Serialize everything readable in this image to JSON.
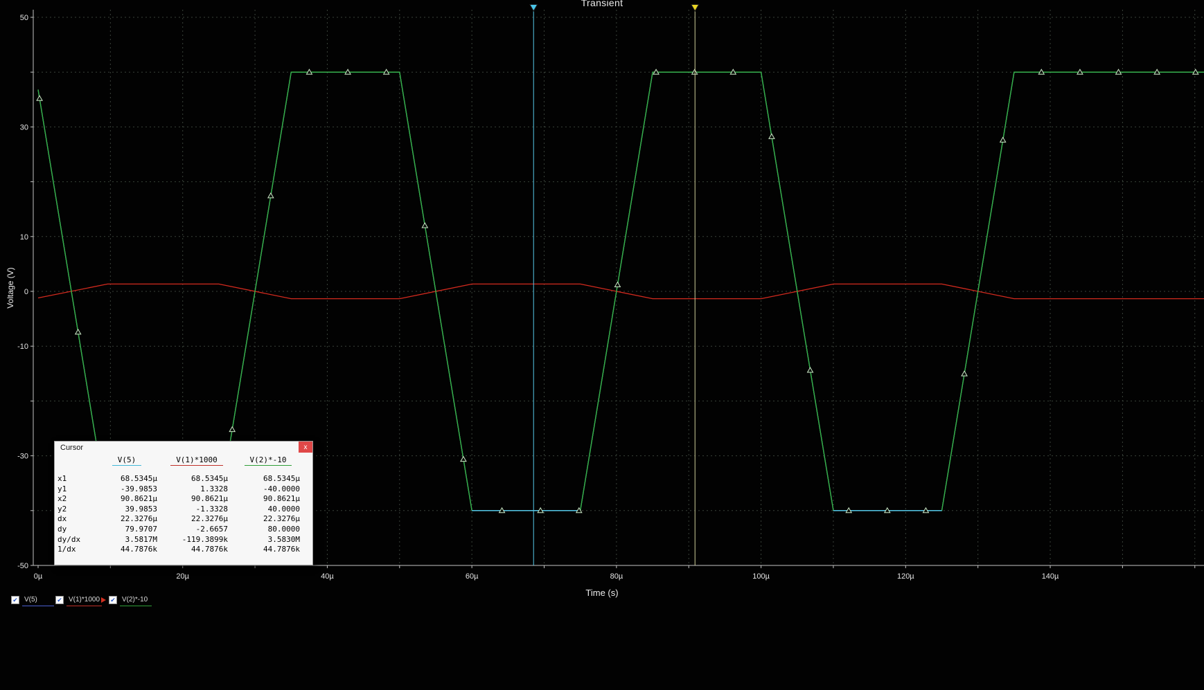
{
  "chart_data": {
    "type": "line",
    "title": "Transient",
    "xlabel": "Time (s)",
    "ylabel": "Voltage (V)",
    "x_unit": "µs",
    "xlim_us": [
      0,
      161.5
    ],
    "ylim": [
      -50,
      50
    ],
    "grid": {
      "x_step_us": 10,
      "y_step_v": 10,
      "color": "#3a423a",
      "style": "dashed"
    },
    "x_ticks": [
      {
        "us": 0,
        "label": "0µ"
      },
      {
        "us": 20,
        "label": "20µ"
      },
      {
        "us": 40,
        "label": "40µ"
      },
      {
        "us": 60,
        "label": "60µ"
      },
      {
        "us": 80,
        "label": "80µ"
      },
      {
        "us": 100,
        "label": "100µ"
      },
      {
        "us": 120,
        "label": "120µ"
      },
      {
        "us": 140,
        "label": "140µ"
      }
    ],
    "y_ticks": [
      {
        "v": 50,
        "label": "50"
      },
      {
        "v": 30,
        "label": "30"
      },
      {
        "v": 10,
        "label": "10"
      },
      {
        "v": 0,
        "label": "0"
      },
      {
        "v": -10,
        "label": "-10"
      },
      {
        "v": -30,
        "label": "-30"
      },
      {
        "v": -50,
        "label": "-50"
      }
    ],
    "series": [
      {
        "name": "V(5)",
        "color": "#55c8e8",
        "points_us_v": [
          [
            0,
            36.8
          ],
          [
            9.6,
            -39.985
          ],
          [
            25,
            -39.985
          ],
          [
            35,
            39.985
          ],
          [
            50,
            39.985
          ],
          [
            60,
            -39.985
          ],
          [
            75,
            -39.985
          ],
          [
            85,
            39.985
          ],
          [
            100,
            39.985
          ],
          [
            110,
            -39.985
          ],
          [
            125,
            -39.985
          ],
          [
            135,
            39.985
          ],
          [
            161.5,
            39.985
          ]
        ],
        "overlay_segments_us": [
          [
            9.6,
            25
          ],
          [
            60,
            75
          ],
          [
            110,
            125
          ]
        ],
        "overlay_v": -40
      },
      {
        "name": "V(1)*1000",
        "color": "#d42a1e",
        "points_us_v": [
          [
            0,
            -1.2
          ],
          [
            9.6,
            1.333
          ],
          [
            25,
            1.333
          ],
          [
            35,
            -1.333
          ],
          [
            50,
            -1.333
          ],
          [
            60,
            1.333
          ],
          [
            75,
            1.333
          ],
          [
            85,
            -1.333
          ],
          [
            100,
            -1.333
          ],
          [
            110,
            1.333
          ],
          [
            125,
            1.333
          ],
          [
            135,
            -1.333
          ],
          [
            161.5,
            -1.333
          ]
        ]
      },
      {
        "name": "V(2)*-10",
        "color": "#35b13f",
        "markers": true,
        "points_us_v": [
          [
            0,
            36.8
          ],
          [
            9.6,
            -40
          ],
          [
            25,
            -40
          ],
          [
            35,
            40
          ],
          [
            50,
            40
          ],
          [
            60,
            -40
          ],
          [
            75,
            -40
          ],
          [
            85,
            40
          ],
          [
            100,
            40
          ],
          [
            110,
            -40
          ],
          [
            125,
            -40
          ],
          [
            135,
            40
          ],
          [
            161.5,
            40
          ]
        ]
      }
    ],
    "marker_start_us": 0.2,
    "marker_interval_us": 5.33,
    "marker_stroke": "#cde8c8",
    "cursors": [
      {
        "name": "cursor-1",
        "x_us": 68.5345,
        "line_color": "#55c8e8",
        "flag_color": "#49c4e8"
      },
      {
        "name": "cursor-2",
        "x_us": 90.8621,
        "line_color": "#cfcf9a",
        "flag_color": "#e8d424"
      }
    ]
  },
  "cursor_window": {
    "title": "Cursor",
    "close_label": "x",
    "columns": [
      "V(5)",
      "V(1)*1000",
      "V(2)*-10"
    ],
    "column_colors": [
      "#40b8d8",
      "#c03028",
      "#2f9e38"
    ],
    "rows": [
      {
        "label": "x1",
        "values": [
          "68.5345µ",
          "68.5345µ",
          "68.5345µ"
        ]
      },
      {
        "label": "y1",
        "values": [
          "-39.9853",
          "1.3328",
          "-40.0000"
        ]
      },
      {
        "label": "x2",
        "values": [
          "90.8621µ",
          "90.8621µ",
          "90.8621µ"
        ]
      },
      {
        "label": "y2",
        "values": [
          "39.9853",
          "-1.3328",
          "40.0000"
        ]
      },
      {
        "label": "dx",
        "values": [
          "22.3276µ",
          "22.3276µ",
          "22.3276µ"
        ]
      },
      {
        "label": "dy",
        "values": [
          "79.9707",
          "-2.6657",
          "80.0000"
        ]
      },
      {
        "label": "dy/dx",
        "values": [
          "3.5817M",
          "-119.3899k",
          "3.5830M"
        ]
      },
      {
        "label": "1/dx",
        "values": [
          "44.7876k",
          "44.7876k",
          "44.7876k"
        ]
      }
    ]
  },
  "legend": [
    {
      "label": "V(5)",
      "underline": "#4a5fd0",
      "checked": true,
      "active": false
    },
    {
      "label": "V(1)*1000",
      "underline": "#c03028",
      "checked": true,
      "active": false
    },
    {
      "label": "V(2)*-10",
      "underline": "#2f9e38",
      "checked": true,
      "active": true
    }
  ]
}
